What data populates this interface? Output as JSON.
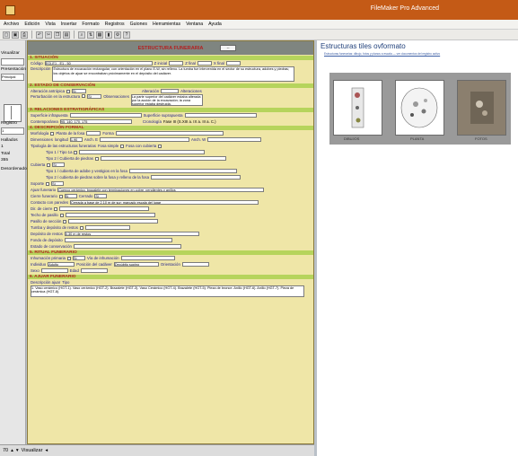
{
  "app": {
    "title": "FileMaker Pro Advanced"
  },
  "menu": [
    "Archivo",
    "Edición",
    "Vista",
    "Insertar",
    "Formato",
    "Registros",
    "Guiones",
    "Herramientas",
    "Ventana",
    "Ayuda"
  ],
  "toolbar": {
    "icons": [
      "new-record-icon",
      "save-icon",
      "print-icon",
      "undo-icon",
      "cut-icon",
      "copy-icon",
      "paste-icon",
      "find-icon",
      "sort-icon",
      "table-icon",
      "chart-icon",
      "tools-icon",
      "help-icon"
    ]
  },
  "left": {
    "visualizar": "Visualizar",
    "presentacion_label": "Presentación",
    "presentacion_value": "Principal",
    "registro": "Registro",
    "registro_value": "1",
    "hallados": "Hallados",
    "hallados_value": "1",
    "total": "Total",
    "total_value": "355",
    "desordenado": "Desordenado"
  },
  "status": {
    "zoom": "70",
    "mode": "Visualizar"
  },
  "form": {
    "header_title": "ESTRUCTURA FUNERARIA",
    "header_btn": "...",
    "sec1": "1. SITUACIÓN",
    "codigo_label": "Código",
    "codigo_value": "EGI-E1 - E1 - 50",
    "z_label": "Z inicial",
    "z_value": "",
    "zlab_label": "Z final",
    "z2_value": "",
    "x_label": "X final",
    "x_value": "",
    "desc_label": "Descripción",
    "desc_value": "Estructura de excavación rectangular, con orientación en el plano E-W, sin relleno. La tumba fue intervenida en el sector de su estructura, adobes y piedras; los objetos de ajuar se encontraban próximamente en el depósito del cadáver.",
    "sec2": "2. ESTADO DE CONSERVACIÓN",
    "alteracion_label": "Alteración antrópica",
    "alteracion_n": "Si",
    "alteracion_val": "Sí",
    "alter2_label": "Alteración",
    "alter2_val": "",
    "alter3_label": "Alteraciones",
    "perturb_label": "Perturbación en la estructura",
    "perturb_val": "Sí",
    "observ_label": "Observaciones",
    "observ_value": "La parte superior del cadáver estaba alterada por la acción de la excavación; la zona superior estaba destruida.",
    "sec3": "3. RELACIONES ESTRATIGRÁFICAS",
    "sup_inf_label": "Superficie infrapuesta",
    "sup_inf_val": "",
    "sup_sup_label": "Superficie suprapuesta",
    "sup_sup_val": "",
    "contemp_label": "Contemporánea",
    "contemp_val": "95, 140, 170, 175",
    "cron_label": "Cronología",
    "cron_val": "Fase III (S.XIII a. IX a. III a. C.)",
    "sec4": "4. DESCRIPCIÓN FORMAL",
    "morfologia_label": "Morfología",
    "planta_label": "Planta de la fosa",
    "forma_label": "Forma",
    "dimensiones_label": "Dimensiones",
    "long_label": "longitud",
    "long_val": "1.90",
    "anch_label": "Anch. E",
    "anch_val": "",
    "anch2_label": "Anch. W",
    "tipologia_label": "Tipología de las estructuras funerarias",
    "tipo_val1": "Fosa simple",
    "tipo_val2": "Fosa con cubierta",
    "tipo_sub": "Tipo 1 / Tipo 1a",
    "tipo_sub2": "Tipo 2 / Cubierta de piedras",
    "cubierta_label": "Cubierta",
    "cubierta_val": "Sí",
    "tipo_c1": "Tipo 1 / cubierta de adobe y vestigios en la fosa",
    "tipo_c2": "Tipo 2 / cubierta de piedras sobre la fosa y relleno de la fosa",
    "soporte_label": "Soporte",
    "soporte_val": "Sí",
    "ajuar_label": "Ajuar funerario",
    "ajuar_val": "Cuenco cerámico, brazalete con terminaciones en cobre, pendientes y anillos",
    "cierre_label": "Cierre funerario",
    "cierre_val": "Sí",
    "cerrado_label": "Cerrado",
    "cierre_sel": "Sí",
    "contacto_label": "Contacto con paredes",
    "contacto_val": "Cerrada a base de 2.10 m de sur; marcado escala del lugar",
    "dir_label": "Dir. de cierre",
    "techo_label": "Techo de pasillo",
    "pasillo_label": "Pasillo de sección",
    "tumba_label": "Tumba y depósito de restos",
    "tumba_val": "",
    "dep_label": "Depósito de restos",
    "dep_val": "0.30 m de restos",
    "fondo_label": "Fondo de depósito",
    "fondo_val": "",
    "estado_label": "Estado de conservación",
    "estado_val": "",
    "sec5": "5. RITUAL FUNERARIO",
    "inhumacion_label": "Inhumación primaria",
    "inhumacion_val": "Sí",
    "via_label": "Vía de inhumación",
    "via_val": "",
    "indiv_label": "Individuo",
    "indiv_val": "Adulto",
    "posicion_label": "Posición del cadáver",
    "posicion_val": "Decúbito supino",
    "orient_label": "Orientación",
    "orient_val": "",
    "sexo_label": "Sexo",
    "sexo_val": "",
    "edad_label": "Edad",
    "edad_val": "",
    "sec6": "6. AJUAR FUNERARIO",
    "ajuar_desc_label": "Descripción ajuar",
    "ajuar_tipo_label": "Tipo",
    "ajuar_desc_val": "1. Vaso cerámico (HGT-1). Vaso cerámico (HGT-2). Brazalete (HGT-3). Vaso Cerámico (HGT-4). Brazalete (HGT-5). Pieza de bronce. Anillo (HGT-6). Anillo (HGT-7). Pieza de cerámica (HGT-8)."
  },
  "right": {
    "title": "Estructuras tiles ovformato",
    "links": "Estructuras funerarias: dibujo, fotos y planos a escala — ver documentos del registro activo",
    "captions": [
      "DIBUJOS",
      "PLANTA",
      "FOTOS"
    ]
  }
}
